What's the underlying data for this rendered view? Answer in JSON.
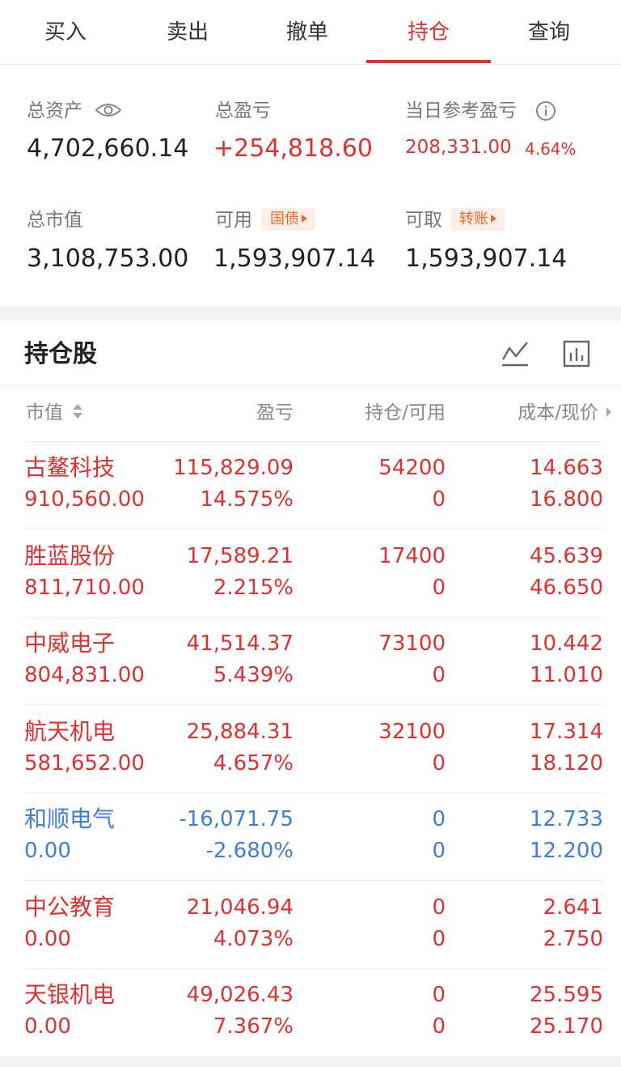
{
  "tabs": [
    "买入",
    "卖出",
    "撤单",
    "持仓",
    "查询"
  ],
  "active_tab": 3,
  "summary": {
    "total_assets_label": "总资产",
    "total_assets": "4,702,660.14",
    "total_pnl_label": "总盈亏",
    "total_pnl": "+254,818.60",
    "daily_pnl_label": "当日参考盈亏",
    "daily_pnl": "208,331.00",
    "daily_pnl_pct": "4.64%",
    "market_value_label": "总市值",
    "market_value": "3,108,753.00",
    "available_label": "可用",
    "available_badge": "国债",
    "available": "1,593,907.14",
    "withdrawable_label": "可取",
    "withdrawable_badge": "转账",
    "withdrawable": "1,593,907.14"
  },
  "holdings": {
    "title": "持仓股",
    "icons": [
      "line-chart-icon",
      "bar-chart-icon"
    ],
    "columns": [
      "市值",
      "盈亏",
      "持仓/可用",
      "成本/现价"
    ],
    "rows": [
      {
        "name": "古鳌科技",
        "market_value": "910,560.00",
        "pnl": "115,829.09",
        "pnl_pct": "14.575%",
        "position": "54200",
        "available": "0",
        "cost": "14.663",
        "price": "16.800",
        "trend": "up"
      },
      {
        "name": "胜蓝股份",
        "market_value": "811,710.00",
        "pnl": "17,589.21",
        "pnl_pct": "2.215%",
        "position": "17400",
        "available": "0",
        "cost": "45.639",
        "price": "46.650",
        "trend": "up"
      },
      {
        "name": "中威电子",
        "market_value": "804,831.00",
        "pnl": "41,514.37",
        "pnl_pct": "5.439%",
        "position": "73100",
        "available": "0",
        "cost": "10.442",
        "price": "11.010",
        "trend": "up"
      },
      {
        "name": "航天机电",
        "market_value": "581,652.00",
        "pnl": "25,884.31",
        "pnl_pct": "4.657%",
        "position": "32100",
        "available": "0",
        "cost": "17.314",
        "price": "18.120",
        "trend": "up"
      },
      {
        "name": "和顺电气",
        "market_value": "0.00",
        "pnl": "-16,071.75",
        "pnl_pct": "-2.680%",
        "position": "0",
        "available": "0",
        "cost": "12.733",
        "price": "12.200",
        "trend": "down"
      },
      {
        "name": "中公教育",
        "market_value": "0.00",
        "pnl": "21,046.94",
        "pnl_pct": "4.073%",
        "position": "0",
        "available": "0",
        "cost": "2.641",
        "price": "2.750",
        "trend": "up"
      },
      {
        "name": "天银机电",
        "market_value": "0.00",
        "pnl": "49,026.43",
        "pnl_pct": "7.367%",
        "position": "0",
        "available": "0",
        "cost": "25.595",
        "price": "25.170",
        "trend": "up"
      }
    ]
  },
  "colors": {
    "up": "#e03131",
    "down": "#3f7fd6",
    "accent": "#e03131",
    "badge": "#ee6a2b"
  }
}
